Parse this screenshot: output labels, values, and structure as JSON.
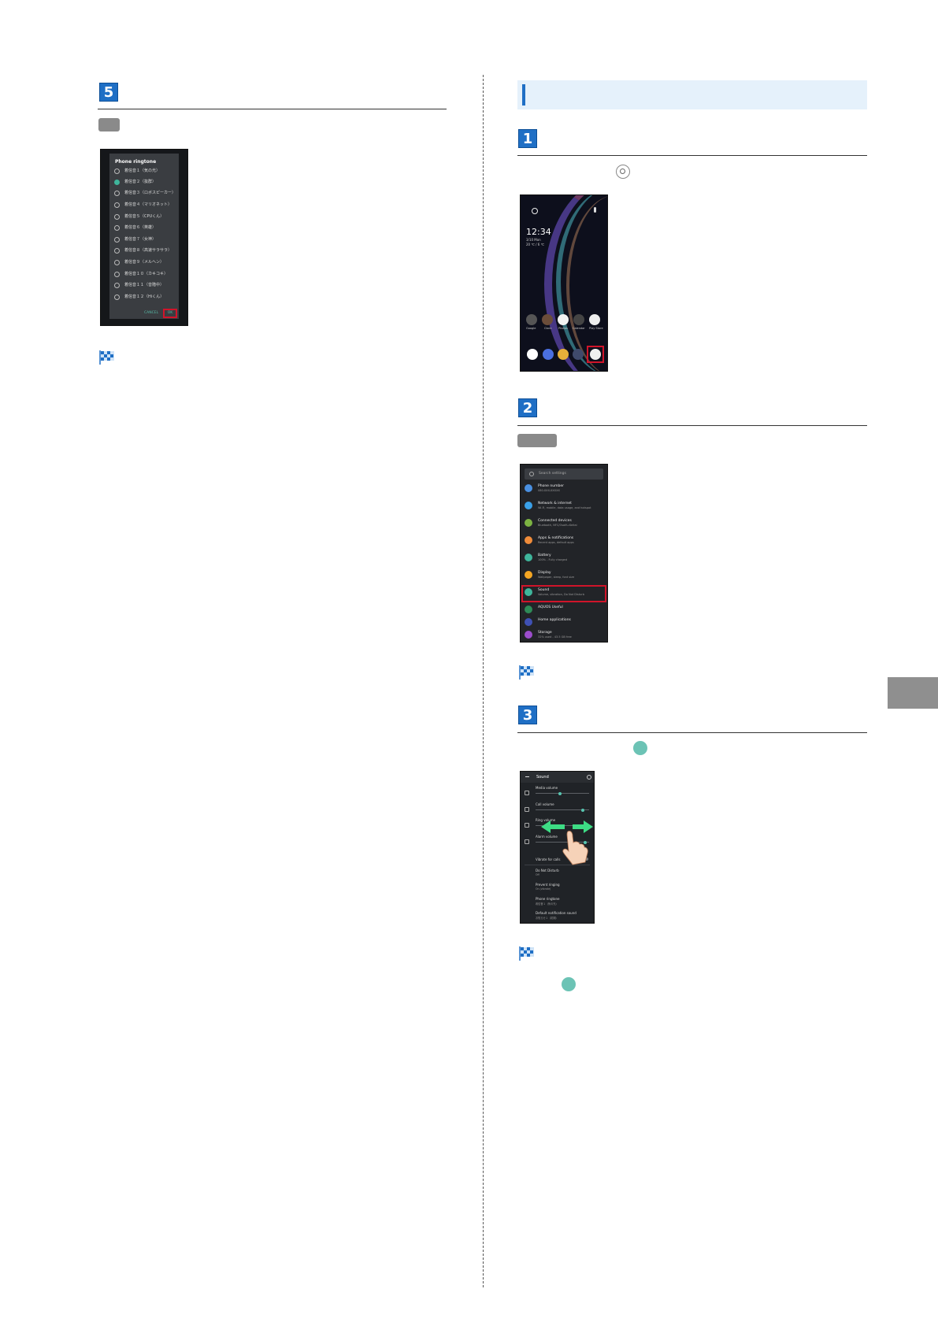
{
  "steps": {
    "s5": "5",
    "s1": "1",
    "s2": "2",
    "s3": "3"
  },
  "left": {
    "dialog": {
      "title": "Phone ringtone",
      "options": [
        "着信音１（気の光）",
        "着信音２（抜群）",
        "着信音３（ロボスピーカー）",
        "着信音４（マリオネット）",
        "着信音５（CPUくん）",
        "着信音６（英雄）",
        "着信音７（女神）",
        "着信音８（高速サラサラ）",
        "着信音９（メルヘン）",
        "着信音１０（カキコキ）",
        "着信音１１（音階中）",
        "着信音１２（Hiくん）"
      ],
      "selected_index": 1,
      "cancel": "CANCEL",
      "ok": "OK"
    }
  },
  "home": {
    "clock": "12:34",
    "date_line1": "3/10 Mon",
    "date_line2": "20 ℃ / 6 ℃",
    "dock_labels": [
      "Google",
      "Clock",
      "Photos",
      "Calendar",
      "Play Store"
    ]
  },
  "settings_list": {
    "search_placeholder": "Search settings",
    "rows": [
      {
        "title": "Phone number",
        "sub": "080-XXX-XXXXX",
        "color": "#4a90e2"
      },
      {
        "title": "Network & internet",
        "sub": "Wi-Fi, mobile, data usage, and hotspot",
        "color": "#3aa0e8"
      },
      {
        "title": "Connected devices",
        "sub": "Bluetooth, NFC/Osaifu-Keitai",
        "color": "#7cb342"
      },
      {
        "title": "Apps & notifications",
        "sub": "Recent apps, default apps",
        "color": "#f08c3a"
      },
      {
        "title": "Battery",
        "sub": "100% - Fully charged",
        "color": "#3fb59b"
      },
      {
        "title": "Display",
        "sub": "Wallpaper, sleep, font size",
        "color": "#f5a623"
      },
      {
        "title": "Sound",
        "sub": "Volume, vibration, Do Not Disturb",
        "color": "#3fb59b"
      },
      {
        "title": "AQUOS Useful",
        "sub": "",
        "color": "#2e8b57"
      },
      {
        "title": "Home applications",
        "sub": "",
        "color": "#3f51b5"
      },
      {
        "title": "Storage",
        "sub": "32% used - 43.5 GB free",
        "color": "#9c4dcc"
      }
    ]
  },
  "sound": {
    "title": "Sound",
    "items": [
      {
        "label": "Media volume",
        "level": 0.45
      },
      {
        "label": "Call volume",
        "level": 0.88
      },
      {
        "label": "Ring volume",
        "level": 0.2
      },
      {
        "label": "Alarm volume",
        "level": 0.92
      }
    ],
    "vibrate": "Vibrate for calls",
    "dnd": "Do Not Disturb",
    "dnd_sub": "Off",
    "prevent": "Prevent ringing",
    "prevent_sub": "On (vibrate)",
    "ringtone": "Phone ringtone",
    "ringtone_sub": "着信音１（気の光）",
    "notif": "Default notification sound",
    "notif_sub": "お知らせ１（初期）"
  }
}
